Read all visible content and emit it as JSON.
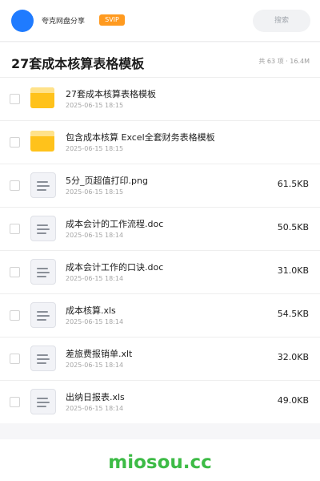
{
  "header": {
    "title": "夸克网盘分享",
    "badge": "SVIP",
    "search_placeholder": "搜索"
  },
  "page": {
    "title": "27套成本核算表格模板",
    "meta": "共 63 项 · 16.4M"
  },
  "files": [
    {
      "name": "27套成本核算表格模板",
      "date": "2025-06-15 18:15",
      "size": "",
      "icon": "folder-icon"
    },
    {
      "name": "包含成本核算 Excel全套财务表格模板",
      "date": "2025-06-15 18:15",
      "size": "",
      "icon": "folder-icon"
    },
    {
      "name": "5分_页超值打印.png",
      "date": "2025-06-15 18:15",
      "size": "61.5KB",
      "icon": "file-icon"
    },
    {
      "name": "成本会计的工作流程.doc",
      "date": "2025-06-15 18:14",
      "size": "50.5KB",
      "icon": "file-icon"
    },
    {
      "name": "成本会计工作的口诀.doc",
      "date": "2025-06-15 18:14",
      "size": "31.0KB",
      "icon": "file-icon"
    },
    {
      "name": "成本核算.xls",
      "date": "2025-06-15 18:14",
      "size": "54.5KB",
      "icon": "file-icon"
    },
    {
      "name": "差旅费报销单.xlt",
      "date": "2025-06-15 18:14",
      "size": "32.0KB",
      "icon": "file-icon"
    },
    {
      "name": "出纳日报表.xls",
      "date": "2025-06-15 18:14",
      "size": "49.0KB",
      "icon": "file-icon"
    }
  ],
  "watermark": "miosou.cc",
  "colors": {
    "avatar": "#1f7bff",
    "svip": "#ff9a1f",
    "folder": "#ffc21b",
    "watermark": "#3dbb46"
  }
}
